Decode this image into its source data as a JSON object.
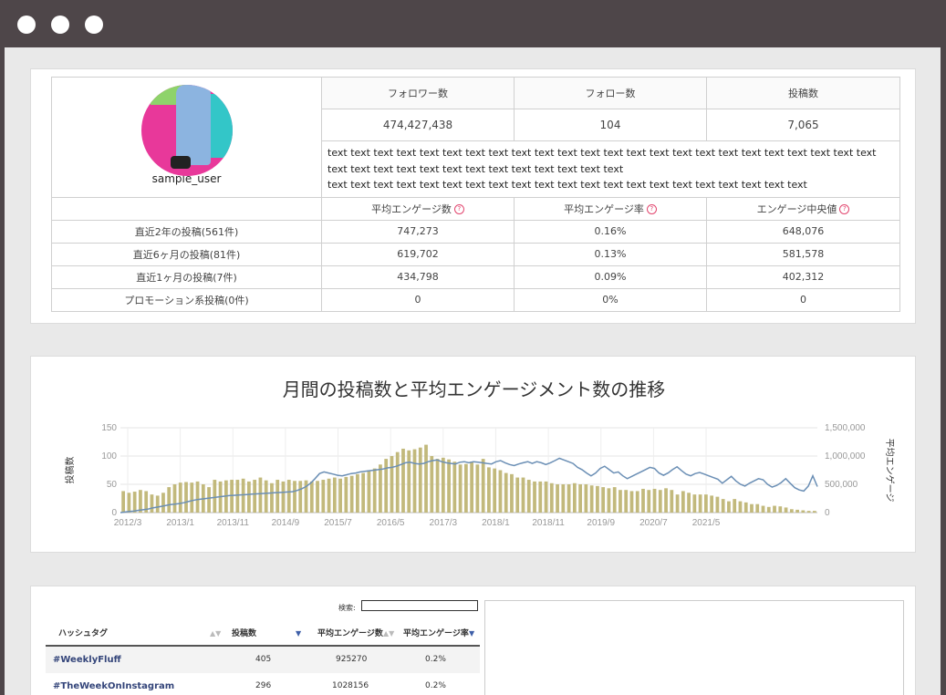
{
  "window": {
    "controls": [
      "close",
      "minimize",
      "maximize"
    ]
  },
  "profile": {
    "username": "sample_user",
    "headers": [
      "フォロワー数",
      "フォロー数",
      "投稿数"
    ],
    "values": [
      "474,427,438",
      "104",
      "7,065"
    ],
    "bio": [
      "text text text text text text text text text text text text text text text text text text text text text text text text",
      "text text text text text text text text text text text text text",
      "text text text text text text text text text text text text text text text text text text text text text"
    ],
    "metric_headers": [
      "平均エンゲージ数",
      "平均エンゲージ率",
      "エンゲージ中央値"
    ],
    "help_icon": "?",
    "rows": [
      {
        "label": "直近2年の投稿(561件)",
        "values": [
          "747,273",
          "0.16%",
          "648,076"
        ]
      },
      {
        "label": "直近6ヶ月の投稿(81件)",
        "values": [
          "619,702",
          "0.13%",
          "581,578"
        ]
      },
      {
        "label": "直近1ヶ月の投稿(7件)",
        "values": [
          "434,798",
          "0.09%",
          "402,312"
        ]
      },
      {
        "label": "プロモーション系投稿(0件)",
        "values": [
          "0",
          "0%",
          "0"
        ]
      }
    ]
  },
  "chart_data": {
    "type": "bar+line",
    "title": "月間の投稿数と平均エンゲージメント数の推移",
    "ylabel_left": "投稿数",
    "ylabel_right": "平均エンゲージ",
    "y_left_ticks": [
      "0",
      "50",
      "100",
      "150"
    ],
    "y_right_ticks": [
      "0",
      "500,000",
      "1,000,000",
      "1,500,000"
    ],
    "ylim_left": [
      0,
      150
    ],
    "ylim_right": [
      0,
      1500000
    ],
    "x_ticks": [
      "2012/3",
      "2013/1",
      "2013/11",
      "2014/9",
      "2015/7",
      "2016/5",
      "2017/3",
      "2018/1",
      "2018/11",
      "2019/9",
      "2020/7",
      "2021/5"
    ],
    "grid": true,
    "series": [
      {
        "kind": "bar",
        "axis": "left",
        "color": "#c2b97c",
        "values": [
          38,
          35,
          37,
          40,
          38,
          32,
          30,
          35,
          45,
          50,
          53,
          54,
          53,
          55,
          50,
          45,
          58,
          55,
          57,
          58,
          58,
          60,
          55,
          58,
          62,
          57,
          52,
          58,
          55,
          58,
          56,
          56,
          57,
          55,
          56,
          58,
          60,
          62,
          60,
          63,
          65,
          68,
          70,
          75,
          78,
          85,
          95,
          100,
          107,
          113,
          110,
          112,
          115,
          120,
          100,
          95,
          97,
          94,
          90,
          85,
          86,
          90,
          85,
          95,
          80,
          78,
          75,
          70,
          68,
          62,
          62,
          58,
          55,
          55,
          55,
          52,
          50,
          50,
          50,
          52,
          50,
          50,
          48,
          47,
          45,
          43,
          45,
          40,
          40,
          38,
          38,
          42,
          40,
          42,
          40,
          43,
          40,
          32,
          38,
          35,
          32,
          32,
          32,
          30,
          28,
          24,
          20,
          24,
          20,
          18,
          15,
          15,
          12,
          10,
          12,
          11,
          9,
          6,
          5,
          4,
          3,
          3
        ]
      },
      {
        "kind": "line",
        "axis": "right",
        "color": "#6b8fb5",
        "values": [
          0,
          10000,
          20000,
          25000,
          40000,
          50000,
          60000,
          80000,
          95000,
          110000,
          125000,
          140000,
          150000,
          160000,
          175000,
          195000,
          215000,
          230000,
          240000,
          250000,
          260000,
          270000,
          280000,
          290000,
          300000,
          305000,
          310000,
          315000,
          320000,
          325000,
          330000,
          335000,
          340000,
          345000,
          350000,
          355000,
          360000,
          365000,
          370000,
          390000,
          420000,
          460000,
          520000,
          600000,
          690000,
          720000,
          700000,
          680000,
          660000,
          650000,
          670000,
          690000,
          700000,
          720000,
          730000,
          740000,
          750000,
          760000,
          770000,
          790000,
          800000,
          820000,
          850000,
          880000,
          890000,
          870000,
          860000,
          870000,
          900000,
          920000,
          930000,
          900000,
          880000,
          870000,
          860000,
          890000,
          900000,
          880000,
          900000,
          890000,
          880000,
          870000,
          860000,
          900000,
          920000,
          880000,
          850000,
          830000,
          860000,
          880000,
          900000,
          870000,
          900000,
          880000,
          850000,
          880000,
          920000,
          960000,
          930000,
          900000,
          870000,
          800000,
          760000,
          700000,
          650000,
          700000,
          780000,
          820000,
          760000,
          700000,
          720000,
          650000,
          600000,
          640000,
          680000,
          720000,
          760000,
          800000,
          780000,
          700000,
          660000,
          700000,
          760000,
          810000,
          740000,
          680000,
          650000,
          690000,
          710000,
          680000,
          650000,
          620000,
          590000,
          520000,
          580000,
          640000,
          560000,
          500000,
          470000,
          520000,
          560000,
          600000,
          580000,
          500000,
          450000,
          480000,
          530000,
          600000,
          520000,
          440000,
          400000,
          380000,
          470000,
          650000,
          460000
        ]
      }
    ]
  },
  "hashtags": {
    "search_label": "検索:",
    "search_value": "",
    "columns": [
      "ハッシュタグ",
      "投稿数",
      "平均エンゲージ数",
      "平均エンゲージ率"
    ],
    "sort_icons": {
      "inactive": "▲▼",
      "active": "▼"
    },
    "rows": [
      {
        "tag": "#WeeklyFluff",
        "posts": "405",
        "avg": "925270",
        "rate": "0.2%"
      },
      {
        "tag": "#TheWeekOnInstagram",
        "posts": "296",
        "avg": "1028156",
        "rate": "0.2%"
      }
    ]
  }
}
